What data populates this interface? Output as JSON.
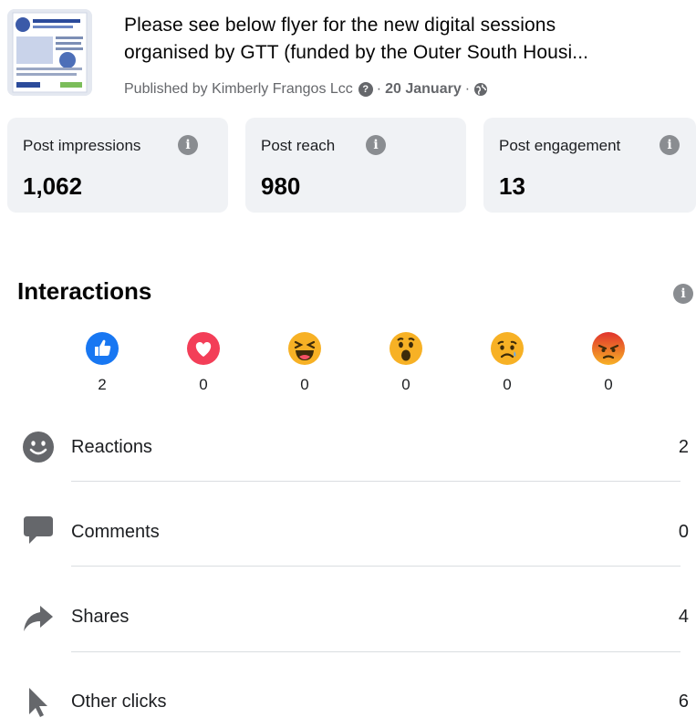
{
  "post": {
    "title_line1": "Please see below flyer for the new digital sessions",
    "title_line2": "organised by GTT (funded by the Outer South Housi...",
    "published_prefix": "Published by Kimberly Frangos Lcc",
    "date_sep": "·",
    "date": "20 January",
    "date_sep2": "·"
  },
  "metrics": [
    {
      "label": "Post impressions",
      "value": "1,062"
    },
    {
      "label": "Post reach",
      "value": "980"
    },
    {
      "label": "Post engagement",
      "value": "13"
    }
  ],
  "interactions": {
    "title": "Interactions",
    "reactions": [
      {
        "icon": "like-reaction-icon",
        "count": "2"
      },
      {
        "icon": "love-reaction-icon",
        "count": "0"
      },
      {
        "icon": "haha-reaction-icon",
        "count": "0"
      },
      {
        "icon": "wow-reaction-icon",
        "count": "0"
      },
      {
        "icon": "sad-reaction-icon",
        "count": "0"
      },
      {
        "icon": "angry-reaction-icon",
        "count": "0"
      }
    ],
    "rows": [
      {
        "label": "Reactions",
        "value": "2",
        "icon": "smiley-icon"
      },
      {
        "label": "Comments",
        "value": "0",
        "icon": "comment-bubble-icon"
      },
      {
        "label": "Shares",
        "value": "4",
        "icon": "share-arrow-icon"
      },
      {
        "label": "Other clicks",
        "value": "6",
        "icon": "pointer-cursor-icon"
      }
    ]
  },
  "colors": {
    "card_bg": "#f0f2f5",
    "info_icon": "#8a8d91",
    "like_blue": "#1877f2",
    "love_red": "#f33e58",
    "emoji_yellow": "#f7b125",
    "angry_red": "#e9710f",
    "muted_text": "#65676b",
    "row_icon": "#65676b"
  }
}
